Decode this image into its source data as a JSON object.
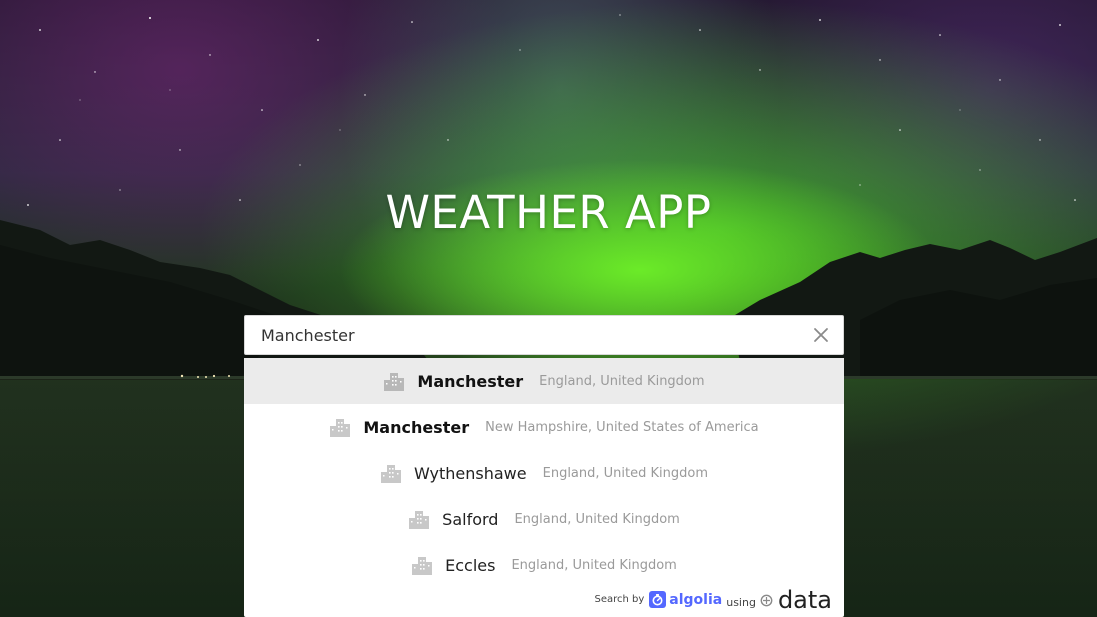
{
  "app": {
    "title": "WEATHER APP"
  },
  "search": {
    "value": "Manchester",
    "placeholder": ""
  },
  "suggestions": [
    {
      "name": "Manchester",
      "region": "England, United Kingdom",
      "icon": "city-icon"
    },
    {
      "name": "Manchester",
      "region": "New Hampshire, United States of America",
      "icon": "city-icon"
    },
    {
      "name": "Wythenshawe",
      "region": "England, United Kingdom",
      "icon": "city-icon"
    },
    {
      "name": "Salford",
      "region": "England, United Kingdom",
      "icon": "city-icon"
    },
    {
      "name": "Eccles",
      "region": "England, United Kingdom",
      "icon": "city-icon"
    }
  ],
  "footer": {
    "search_by": "Search by",
    "algolia": "algolia",
    "using": "using",
    "data": "data"
  },
  "colors": {
    "algolia_brand": "#5468ff",
    "aurora_green": "#6ef028",
    "active_row": "#ebebeb"
  },
  "icons": {
    "clear": "close-icon",
    "suggestion": "city-icon",
    "algolia": "algolia-logo-icon",
    "geo": "geonames-logo-icon"
  }
}
